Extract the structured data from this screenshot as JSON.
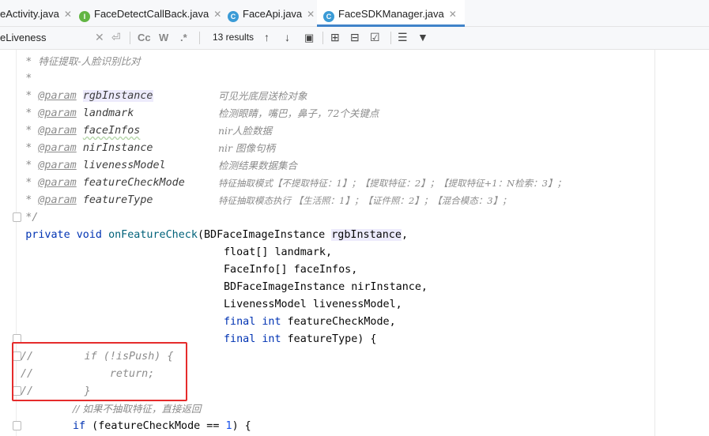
{
  "tabs": [
    {
      "label": "eActivity.java",
      "icon": "class-icon",
      "active": false
    },
    {
      "label": "FaceDetectCallBack.java",
      "icon": "interface-icon",
      "active": false
    },
    {
      "label": "FaceApi.java",
      "icon": "class-icon",
      "active": false
    },
    {
      "label": "FaceSDKManager.java",
      "icon": "class-icon",
      "active": true
    }
  ],
  "find": {
    "query": "eLiveness",
    "results": "13 results",
    "match_case": "Cc",
    "words": "W",
    "regex": ".*"
  },
  "code": {
    "doc_title": "特征提取-人脸识别比对",
    "params": [
      {
        "tag": "@param",
        "name": "rgbInstance",
        "desc": "可见光底层送检对象"
      },
      {
        "tag": "@param",
        "name": "landmark",
        "desc": "检测眼睛，嘴巴，鼻子，72个关键点"
      },
      {
        "tag": "@param",
        "name": "faceInfos",
        "desc": "nir人脸数据"
      },
      {
        "tag": "@param",
        "name": "nirInstance",
        "desc": "nir 图像句柄"
      },
      {
        "tag": "@param",
        "name": "livenessModel",
        "desc": "检测结果数据集合"
      },
      {
        "tag": "@param",
        "name": "featureCheckMode",
        "desc": "特征抽取模式【不提取特征：1】；【提取特征：2】；【提取特征+1：N检索：3】；"
      },
      {
        "tag": "@param",
        "name": "featureType",
        "desc": "特征抽取模态执行 【生活照：1】；【证件照：2】；【混合模态：3】；"
      }
    ],
    "sig": {
      "mod_private": "private",
      "ret_void": "void",
      "method": "onFeatureCheck",
      "p1": "(BDFaceImageInstance ",
      "p1name": "rgbInstance",
      "p2": "float[] landmark,",
      "p3": "FaceInfo[] faceInfos,",
      "p4": "BDFaceImageInstance nirInstance,",
      "p5": "LivenessModel livenessModel,",
      "kw_final": "final",
      "kw_int": "int",
      "p6": "featureCheckMode,",
      "p7": "featureType) {"
    },
    "commented": [
      "//        if (!isPush) {",
      "//            return;",
      "//        }"
    ],
    "comment_line": "// 如果不抽取特征，直接返回",
    "if_kw": "if",
    "if_cond": " (featureCheckMode == ",
    "if_num": "1",
    "if_end": ") {"
  }
}
